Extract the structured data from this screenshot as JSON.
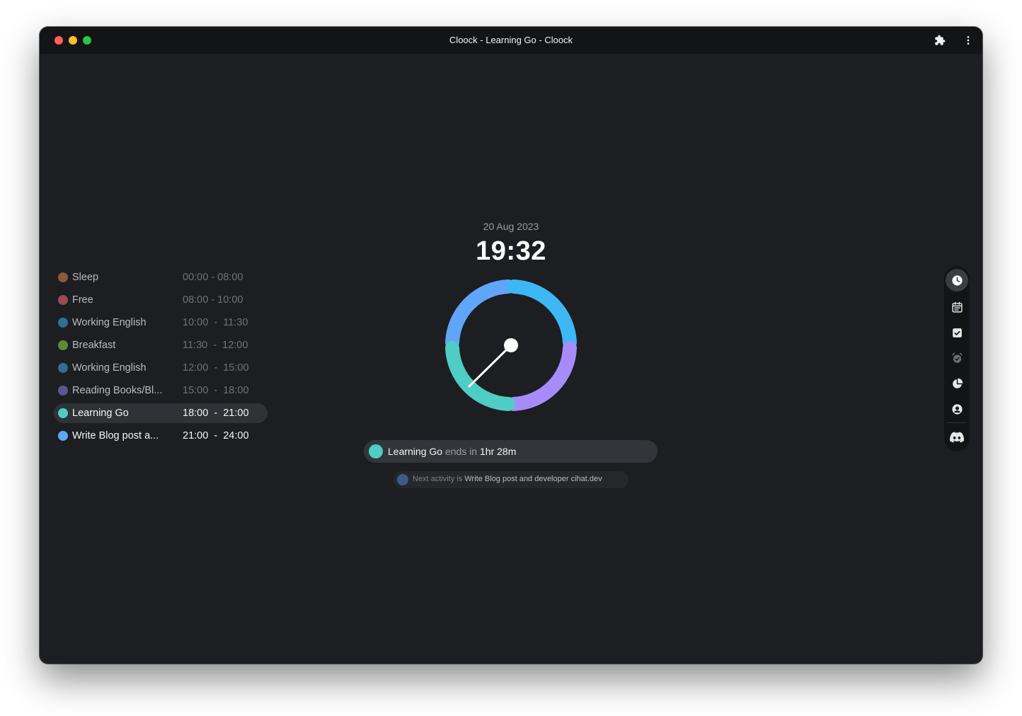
{
  "window": {
    "title": "Cloock - Learning Go - Cloock",
    "icons": [
      "close-icon",
      "minimize-icon",
      "maximize-icon",
      "puzzle-icon",
      "more-vertical-icon"
    ]
  },
  "clock": {
    "date": "20 Aug 2023",
    "time": "19:32"
  },
  "schedule": [
    {
      "name": "Sleep",
      "time": "00:00 - 08:00",
      "color": "#8a5a3c"
    },
    {
      "name": "Free",
      "time": "08:00 - 10:00",
      "color": "#9a4a55"
    },
    {
      "name": "Working English",
      "time": "10:00  -  11:30",
      "color": "#2f6f92"
    },
    {
      "name": "Breakfast",
      "time": "11:30  -  12:00",
      "color": "#5d8a3a"
    },
    {
      "name": "Working English",
      "time": "12:00  -  15:00",
      "color": "#2f6f92"
    },
    {
      "name": "Reading Books/Bl...",
      "time": "15:00  -  18:00",
      "color": "#5d5494"
    },
    {
      "name": "Learning Go",
      "time": "18:00  -  21:00",
      "color": "#4ecdc4"
    },
    {
      "name": "Write Blog post a...",
      "time": "21:00  -  24:00",
      "color": "#60a5fa"
    }
  ],
  "status": {
    "activity": "Learning Go",
    "ends_in_label": "ends in",
    "remaining": "1hr 28m",
    "color": "#4ecdc4"
  },
  "next": {
    "label": "Next activity is",
    "activity": "Write Blog post and developer cihat.dev",
    "color": "#3d5a8a"
  },
  "sidebar": {
    "items": [
      "clock-icon",
      "calendar-icon",
      "checkbox-icon",
      "alarm-icon",
      "pie-chart-icon",
      "user-icon",
      "discord-icon"
    ],
    "selected": "clock-icon"
  },
  "colors": {
    "background": "#1c1e21",
    "arc_top_left": "#60a5fa",
    "arc_top_right": "#3eb8f5",
    "arc_bottom_left": "#4ecdc4",
    "arc_bottom_right": "#a78bfa"
  }
}
